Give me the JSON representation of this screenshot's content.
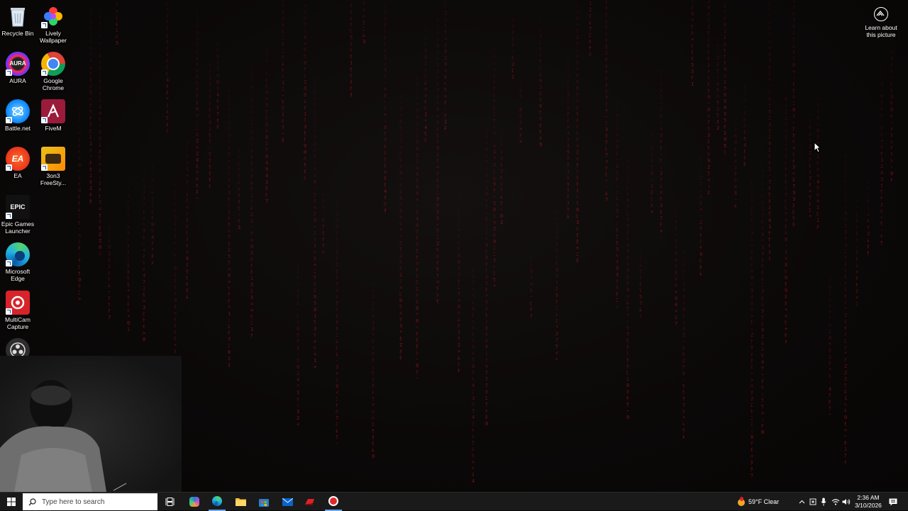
{
  "desktop": {
    "icons": [
      {
        "label": "Recycle Bin",
        "icon": "recycle-bin-icon"
      },
      {
        "label": "Lively Wallpaper",
        "icon": "lively-wallpaper-icon"
      },
      {
        "label": "AURA",
        "icon": "aura-icon"
      },
      {
        "label": "Google Chrome",
        "icon": "chrome-icon"
      },
      {
        "label": "Battle.net",
        "icon": "battlenet-icon"
      },
      {
        "label": "FiveM",
        "icon": "fivem-icon"
      },
      {
        "label": "EA",
        "icon": "ea-icon"
      },
      {
        "label": "3on3 FreeSty...",
        "icon": "3on3-freestyle-icon"
      },
      {
        "label": "Epic Games Launcher",
        "icon": "epic-games-icon"
      },
      {
        "label": "Microsoft Edge",
        "icon": "edge-icon"
      },
      {
        "label": "MultiCam Capture",
        "icon": "multicam-icon"
      },
      {
        "label": "",
        "icon": "obs-icon"
      }
    ],
    "aura_text": "AURA",
    "epic_text": "EPIC",
    "ea_text": "EA",
    "learn_label": "Learn about this picture"
  },
  "taskbar": {
    "search_placeholder": "Type here to search",
    "weather": "59°F  Clear",
    "time": "2:36 AM",
    "date": "3/10/2026",
    "pinned": [
      "copilot-icon",
      "edge-icon",
      "file-explorer-icon",
      "store-icon",
      "mail-icon",
      "app-red-icon",
      "app-dark-icon"
    ]
  },
  "colors": {
    "matrix_red": "#b0141c",
    "taskbar_bg": "#1a1a1a",
    "accent": "#2b7cd3"
  }
}
